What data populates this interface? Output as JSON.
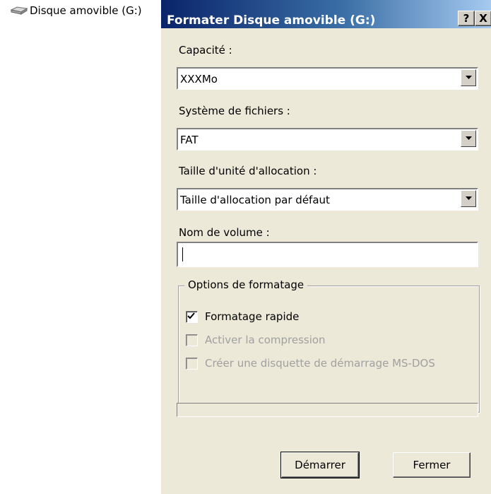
{
  "explorer": {
    "drive_label": "Disque amovible (G:)",
    "drive_icon": "removable-drive-icon"
  },
  "dialog": {
    "title": "Formater Disque amovible (G:)",
    "help_label": "?",
    "close_label": "X",
    "capacity": {
      "label": "Capacité :",
      "value": "XXXMo"
    },
    "filesystem": {
      "label": "Système de fichiers :",
      "value": "FAT"
    },
    "allocation": {
      "label": "Taille d'unité d'allocation :",
      "value": "Taille d'allocation par défaut"
    },
    "volume_name": {
      "label": "Nom de volume :",
      "value": ""
    },
    "options": {
      "legend": "Options de formatage",
      "quick_format": {
        "label": "Formatage rapide",
        "checked": true,
        "enabled": true
      },
      "compression": {
        "label": "Activer la compression",
        "checked": false,
        "enabled": false
      },
      "msdos_disk": {
        "label": "Créer une disquette de démarrage MS-DOS",
        "checked": false,
        "enabled": false
      }
    },
    "progress": 0,
    "start_button": "Démarrer",
    "close_button": "Fermer"
  },
  "colors": {
    "titlebar_start": "#0a246a",
    "titlebar_end": "#a6caf0",
    "dialog_bg": "#ece9d8",
    "disabled_text": "#a0a0a0"
  }
}
